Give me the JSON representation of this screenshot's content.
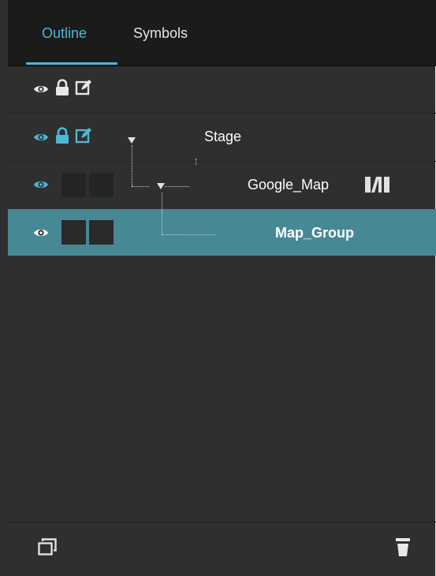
{
  "tabs": [
    {
      "label": "Outline",
      "active": true
    },
    {
      "label": "Symbols",
      "active": false
    }
  ],
  "toolbar_row": {
    "icons": [
      "eye-icon",
      "lock-icon",
      "edit-icon"
    ]
  },
  "layers": [
    {
      "name": "Stage",
      "icons": [
        "eye-icon",
        "lock-icon",
        "edit-icon"
      ],
      "expanded": true
    },
    {
      "name": "Google_Map",
      "icons": [
        "eye-icon"
      ],
      "expanded": true,
      "badge": "symbol-icon"
    },
    {
      "name": "Map_Group",
      "icons": [
        "eye-icon"
      ],
      "selected": true
    }
  ],
  "footer": {
    "icons": [
      "duplicate-icon",
      "trash-icon"
    ]
  },
  "colors": {
    "accent": "#4fb6d6",
    "selected_row": "#468995",
    "panel_bg": "#2f2f2f",
    "header_bg": "#1b1b1b"
  }
}
